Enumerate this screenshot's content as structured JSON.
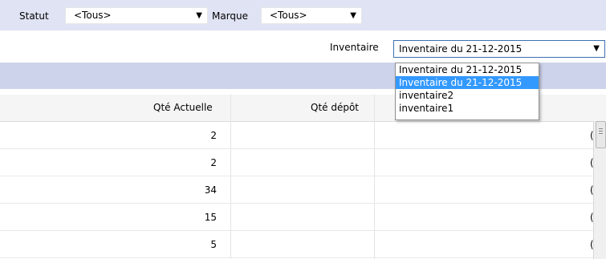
{
  "filters": {
    "statut_label": "Statut",
    "statut_value": "<Tous>",
    "marque_label": "Marque",
    "marque_value": "<Tous>",
    "inventaire_label": "Inventaire",
    "inventaire_value": "Inventaire du 21-12-2015"
  },
  "dropdown": {
    "options": [
      "Inventaire du 21-12-2015",
      "Inventaire du 21-12-2015",
      "inventaire2",
      "inventaire1"
    ],
    "selected_index": 1
  },
  "table": {
    "columns": [
      "Qté Actuelle",
      "Qté dépôt"
    ],
    "rows": [
      {
        "qte_actuelle": "2",
        "trailing": "("
      },
      {
        "qte_actuelle": "2",
        "trailing": "("
      },
      {
        "qte_actuelle": "34",
        "trailing": "("
      },
      {
        "qte_actuelle": "15",
        "trailing": "("
      },
      {
        "qte_actuelle": "5",
        "trailing": "("
      }
    ]
  },
  "colors": {
    "topbar": "#dfe3f3",
    "bluebar": "#cdd3ea",
    "selection": "#3399ff"
  }
}
